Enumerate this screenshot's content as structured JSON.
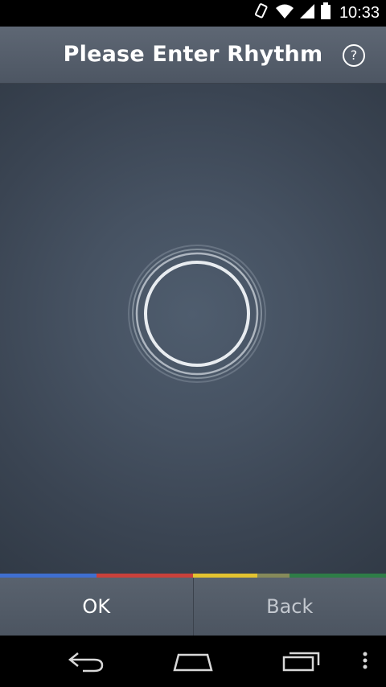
{
  "status_bar": {
    "time": "10:33"
  },
  "header": {
    "title": "Please Enter Rhythm",
    "help_symbol": "?"
  },
  "footer": {
    "ok_label": "OK",
    "back_label": "Back"
  },
  "accent_strip_colors": [
    "#3f6fd0",
    "#c9413b",
    "#e3c330",
    "#868a5a",
    "#2e7d47"
  ],
  "icons": {
    "status": [
      "rotation-icon",
      "wifi-icon",
      "signal-icon",
      "battery-icon"
    ],
    "nav": [
      "back-icon",
      "home-icon",
      "recents-icon",
      "menu-icon"
    ]
  }
}
